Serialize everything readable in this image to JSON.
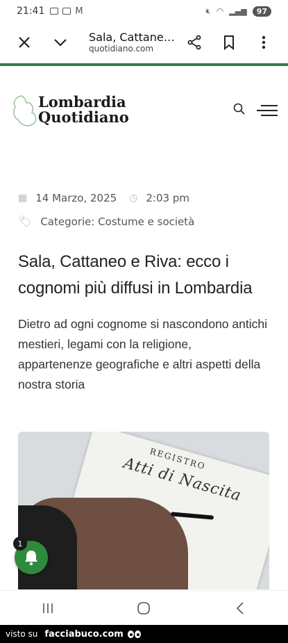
{
  "status_bar": {
    "time": "21:41",
    "battery": "97"
  },
  "browser": {
    "title": "Sala, Cattane…",
    "url": "quotidiano.com",
    "close_icon": "close-icon",
    "chevron_icon": "chevron-down-icon",
    "share_icon": "share-icon",
    "bookmark_icon": "bookmark-icon",
    "more_icon": "more-vert-icon",
    "accent_color": "#2e7d46"
  },
  "site": {
    "logo_line1": "Lombardia",
    "logo_line2": "Quotidiano"
  },
  "article": {
    "date": "14 Marzo, 2025",
    "time": "2:03 pm",
    "categories": "Categorie: Costume e società",
    "headline": "Sala, Cattaneo e Riva: ecco i cognomi più diffusi in Lombardia",
    "subheadline": "Dietro ad ogni cognome si nascondono antichi mestieri, legami con la religione, appartenenze geografiche e altri aspetti della nostra storia",
    "image": {
      "line1": "REGISTRO",
      "line2": "Atti di Nascita"
    }
  },
  "notification": {
    "badge_count": "1",
    "color": "#2e8b3e"
  },
  "footer": {
    "prefix": "visto su",
    "brand": "facciabuco.com"
  }
}
